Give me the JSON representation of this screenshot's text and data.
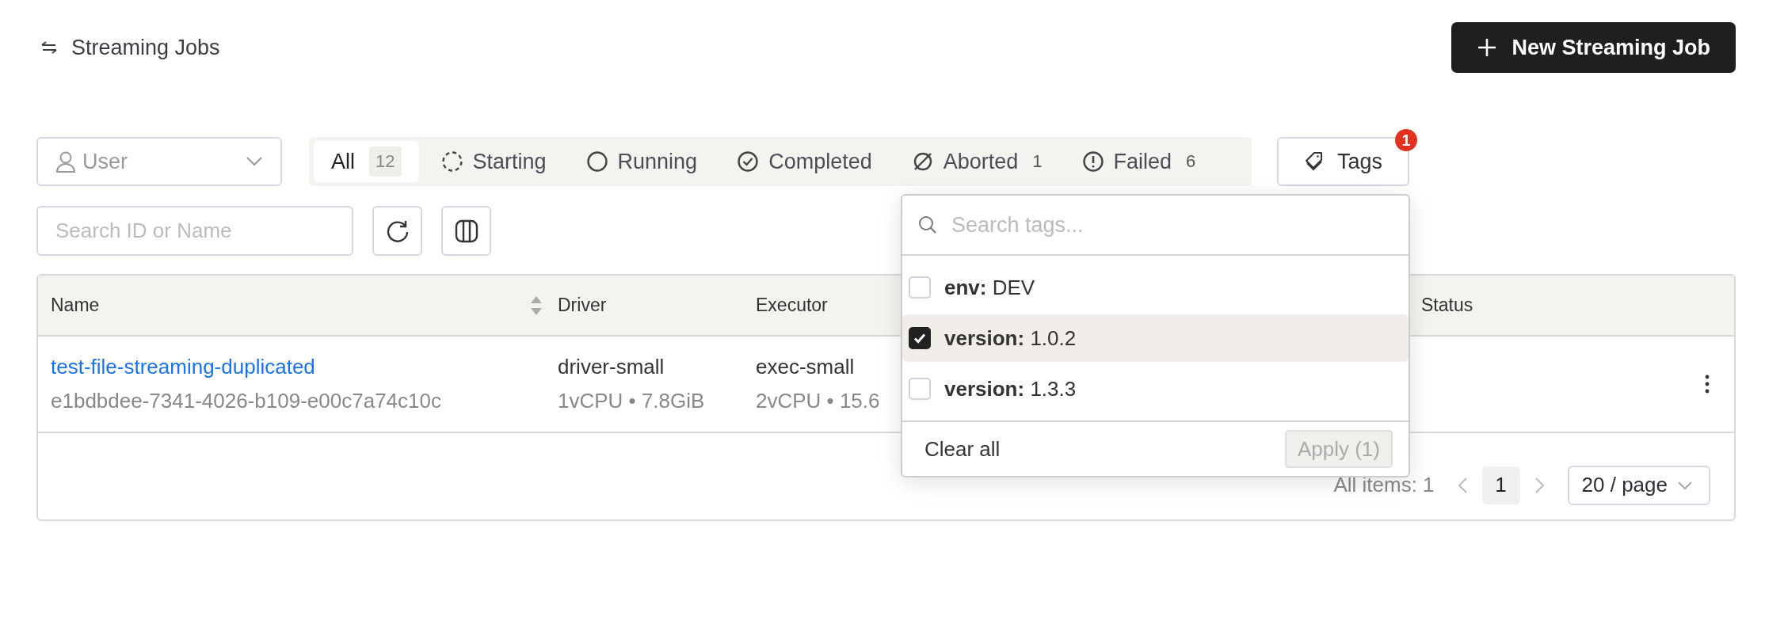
{
  "page": {
    "title": "Streaming Jobs",
    "new_button": "New Streaming Job"
  },
  "filters": {
    "user_placeholder": "User",
    "statuses": [
      {
        "kind": "all",
        "label": "All",
        "count": "12",
        "selected": true
      },
      {
        "kind": "starting",
        "label": "Starting",
        "selected": false
      },
      {
        "kind": "running",
        "label": "Running",
        "selected": false
      },
      {
        "kind": "completed",
        "label": "Completed",
        "selected": false
      },
      {
        "kind": "aborted",
        "label": "Aborted",
        "count": "1",
        "selected": false
      },
      {
        "kind": "failed",
        "label": "Failed",
        "count": "6",
        "selected": false
      }
    ],
    "tags_button": "Tags",
    "tags_badge": "1",
    "search_placeholder": "Search ID or Name"
  },
  "table": {
    "columns": [
      "Name",
      "Driver",
      "Executor",
      "Status"
    ],
    "rows": [
      {
        "name": "test-file-streaming-duplicated",
        "id": "e1bdbdee-7341-4026-b109-e00c7a74c10c",
        "driver": "driver-small",
        "driver_spec": "1vCPU • 7.8GiB",
        "executor": "exec-small",
        "executor_spec": "2vCPU • 15.6"
      }
    ],
    "footer": {
      "total": "All items: 1",
      "page": "1",
      "page_size": "20 / page"
    }
  },
  "tags_dropdown": {
    "placeholder": "Search tags...",
    "items": [
      {
        "key": "env:",
        "value": "DEV",
        "checked": false,
        "selected": false
      },
      {
        "key": "version:",
        "value": "1.0.2",
        "checked": true,
        "selected": true
      },
      {
        "key": "version:",
        "value": "1.3.3",
        "checked": false,
        "selected": false
      }
    ],
    "clear": "Clear all",
    "apply": "Apply (1)"
  }
}
